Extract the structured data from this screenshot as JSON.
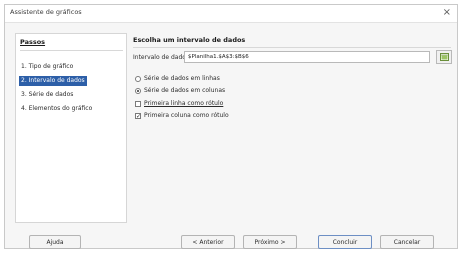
{
  "window": {
    "title": "Assistente de gráficos",
    "close_glyph": "×"
  },
  "steps": {
    "heading": "Passos",
    "items": [
      {
        "label": "1. Tipo de gráfico",
        "active": false
      },
      {
        "label": "2. Intervalo de dados",
        "active": true
      },
      {
        "label": "3. Série de dados",
        "active": false
      },
      {
        "label": "4. Elementos do gráfico",
        "active": false
      }
    ]
  },
  "range": {
    "title": "Escolha um intervalo de dados",
    "label": "Intervalo de dados:",
    "value": "$Planilha1.$A$3:$B$6",
    "button_icon": "range-select-icon"
  },
  "options": {
    "rows_radio": {
      "label": "Série de dados em linhas",
      "selected": false
    },
    "cols_radio": {
      "label": "Série de dados em colunas",
      "selected": true
    },
    "first_row_check": {
      "label": "Primeira linha como rótulo",
      "checked": false
    },
    "first_col_check": {
      "label": "Primeira coluna como rótulo",
      "checked": true
    }
  },
  "buttons": {
    "help": "Ajuda",
    "back": "< Anterior",
    "next": "Próximo >",
    "finish": "Concluir",
    "cancel": "Cancelar"
  }
}
